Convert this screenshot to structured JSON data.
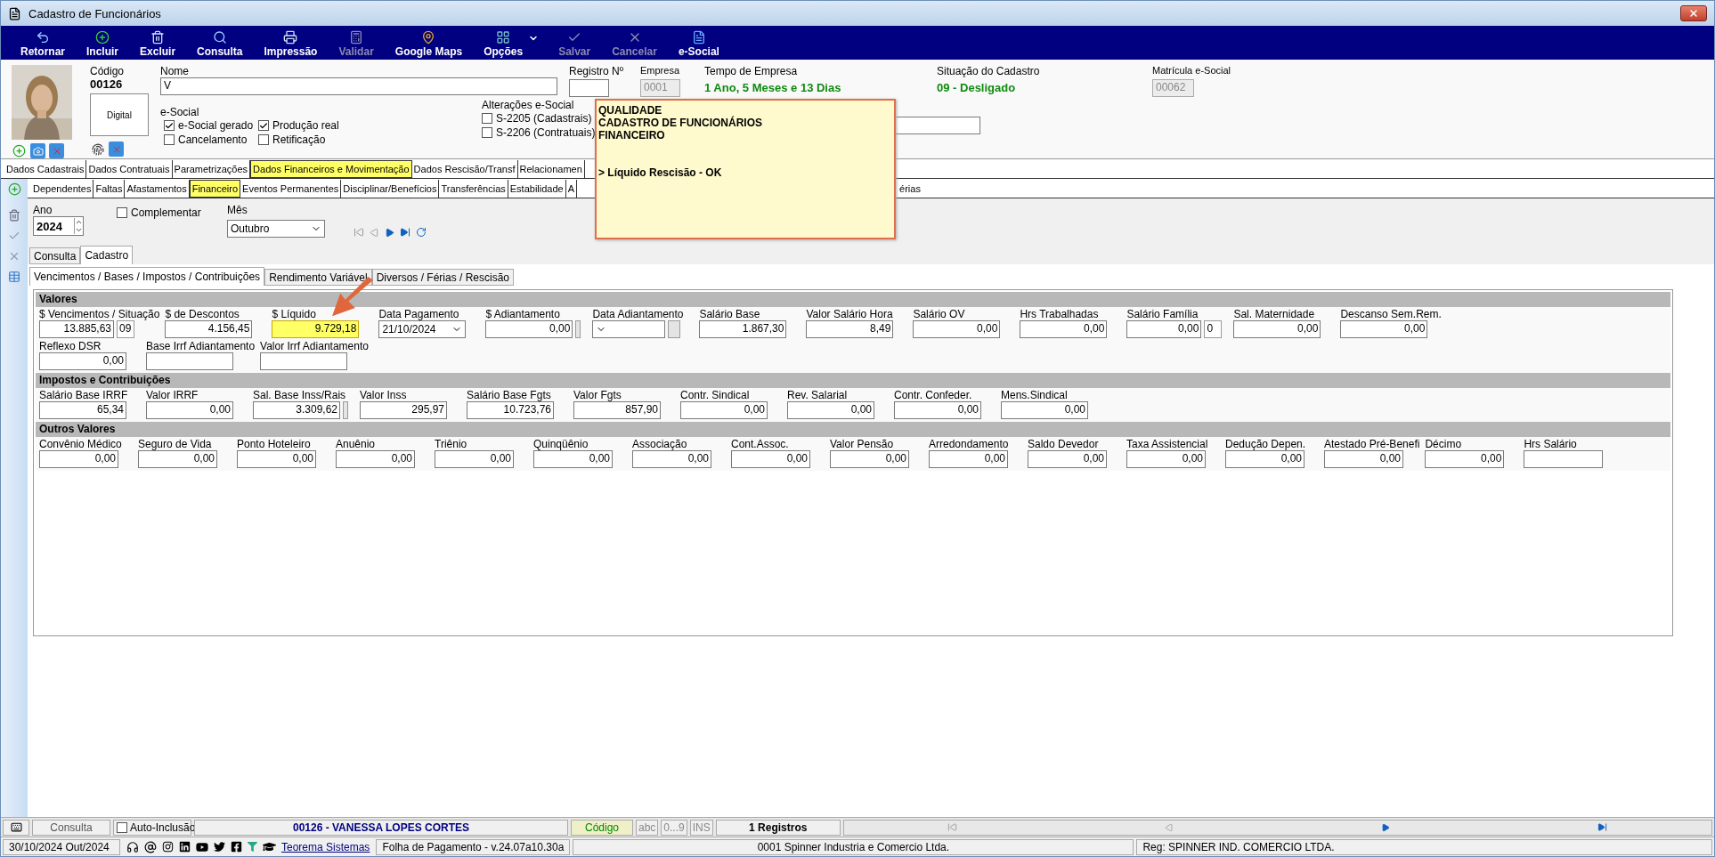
{
  "window": {
    "title": "Cadastro de Funcionários"
  },
  "toolbar": [
    {
      "label": "Retornar",
      "disabled": false,
      "menu": false
    },
    {
      "label": "Incluir",
      "disabled": false,
      "menu": false
    },
    {
      "label": "Excluir",
      "disabled": false,
      "menu": false
    },
    {
      "label": "Consulta",
      "disabled": false,
      "menu": false
    },
    {
      "label": "Impressão",
      "disabled": false,
      "menu": false
    },
    {
      "label": "Validar",
      "disabled": true,
      "menu": false
    },
    {
      "label": "Google Maps",
      "disabled": false,
      "menu": false
    },
    {
      "label": "Opções",
      "disabled": false,
      "menu": true
    },
    {
      "label": "Salvar",
      "disabled": true,
      "menu": false
    },
    {
      "label": "Cancelar",
      "disabled": true,
      "menu": false
    },
    {
      "label": "e-Social",
      "disabled": false,
      "menu": false
    }
  ],
  "header": {
    "codigo_label": "Código",
    "codigo": "00126",
    "digital": "Digital",
    "nome_label": "Nome",
    "nome": "V",
    "registro_label": "Registro Nº",
    "empresa_label": "Empresa",
    "empresa": "0001",
    "tempo_label": "Tempo de Empresa",
    "tempo": "1 Ano, 5 Meses  e 13 Dias",
    "situacao_label": "Situação do Cadastro",
    "situacao": "09 - Desligado",
    "matricula_label": "Matrícula e-Social",
    "matricula": "00062",
    "esocial_label": "e-Social",
    "esocial": [
      {
        "label": "e-Social gerado",
        "checked": true
      },
      {
        "label": "Produção real",
        "checked": true
      },
      {
        "label": "Cancelamento",
        "checked": false
      },
      {
        "label": "Retificação",
        "checked": false
      }
    ],
    "alteracoes_label": "Alterações e-Social",
    "alteracoes": [
      {
        "label": "S-2205 (Cadastrais)",
        "checked": false
      },
      {
        "label": "S-2206 (Contratuais)",
        "checked": false
      }
    ]
  },
  "note": {
    "lines": [
      "QUALIDADE",
      "CADASTRO DE FUNCIONÁRIOS",
      "FINANCEIRO"
    ],
    "message": "> Líquido Rescisão - OK"
  },
  "main_tabs": [
    {
      "label": "Dados Cadastrais",
      "selected": false
    },
    {
      "label": "Dados Contratuais",
      "selected": false
    },
    {
      "label": "Parametrizações",
      "selected": false
    },
    {
      "label": "Dados Financeiros e Movimentação",
      "selected": true
    },
    {
      "label": "Dados Rescisão/Transf",
      "selected": false
    },
    {
      "label": "Relacionamen",
      "selected": false
    }
  ],
  "sub_tabs": [
    {
      "label": "Dependentes",
      "selected": false
    },
    {
      "label": "Faltas",
      "selected": false
    },
    {
      "label": "Afastamentos",
      "selected": false
    },
    {
      "label": "Financeiro",
      "selected": true
    },
    {
      "label": "Eventos Permanentes",
      "selected": false
    },
    {
      "label": "Disciplinar/Benefícios",
      "selected": false
    },
    {
      "label": "Transferências",
      "selected": false
    },
    {
      "label": "Estabilidade",
      "selected": false
    },
    {
      "label": "A",
      "selected": false
    }
  ],
  "sub_tabs_right": [
    "érias"
  ],
  "filter": {
    "ano_label": "Ano",
    "ano": "2024",
    "complementar": {
      "label": "Complementar",
      "checked": false
    },
    "mes_label": "Mês",
    "mes": "Outubro"
  },
  "view_tabs": [
    {
      "label": "Consulta",
      "selected": false
    },
    {
      "label": "Cadastro",
      "selected": true
    }
  ],
  "page_tabs": [
    {
      "label": "Vencimentos / Bases / Impostos / Contribuições",
      "selected": true
    },
    {
      "label": "Rendimento Variável",
      "selected": false
    },
    {
      "label": "Diversos / Férias / Rescisão",
      "selected": false
    }
  ],
  "sections": [
    {
      "title": "Valores",
      "rows": [
        [
          {
            "label": "$ Vencimentos / Situação",
            "value": "13.885,63",
            "kind": "code",
            "code": "09",
            "highlighted": false
          },
          {
            "label": "$ de Descontos",
            "value": "4.156,45",
            "kind": "number",
            "highlighted": false
          },
          {
            "label": "$ Líquido",
            "value": "9.729,18",
            "kind": "number",
            "highlighted": true
          },
          {
            "label": "Data Pagamento",
            "value": "21/10/2024",
            "kind": "select",
            "highlighted": false
          },
          {
            "label": "$ Adiantamento",
            "value": "0,00",
            "kind": "button",
            "highlighted": false
          },
          {
            "label": "Data Adiantamento",
            "kind": "select_button",
            "highlighted": false
          },
          {
            "label": "Salário Base",
            "value": "1.867,30",
            "kind": "number",
            "highlighted": false
          },
          {
            "label": "Valor Salário Hora",
            "value": "8,49",
            "kind": "number",
            "highlighted": false
          },
          {
            "label": "Salário OV",
            "value": "0,00",
            "kind": "number",
            "highlighted": false
          },
          {
            "label": "Hrs Trabalhadas",
            "value": "0,00",
            "kind": "number",
            "highlighted": false
          },
          {
            "label": "Salário Família",
            "value": "0,00",
            "kind": "code",
            "code": "0",
            "highlighted": false
          },
          {
            "label": "Sal. Maternidade",
            "value": "0,00",
            "kind": "number",
            "highlighted": false
          },
          {
            "label": "Descanso Sem.Rem.",
            "value": "0,00",
            "kind": "number",
            "highlighted": false
          }
        ],
        [
          {
            "label": "Reflexo DSR",
            "value": "0,00",
            "kind": "number",
            "highlighted": false
          },
          {
            "label": "Base Irrf Adiantamento",
            "kind": "number",
            "highlighted": false
          },
          {
            "label": "Valor Irrf Adiantamento",
            "kind": "number",
            "highlighted": false
          }
        ]
      ]
    },
    {
      "title": "Impostos e Contribuições",
      "rows": [
        [
          {
            "label": "Salário Base IRRF",
            "value": "65,34",
            "kind": "number",
            "highlighted": false
          },
          {
            "label": "Valor IRRF",
            "value": "0,00",
            "kind": "number",
            "highlighted": false
          },
          {
            "label": "Sal. Base Inss/Rais",
            "value": "3.309,62",
            "kind": "button",
            "highlighted": false
          },
          {
            "label": "Valor Inss",
            "value": "295,97",
            "kind": "number",
            "highlighted": false
          },
          {
            "label": "Salário Base Fgts",
            "value": "10.723,76",
            "kind": "number",
            "highlighted": false
          },
          {
            "label": "Valor Fgts",
            "value": "857,90",
            "kind": "number",
            "highlighted": false
          },
          {
            "label": "Contr. Sindical",
            "value": "0,00",
            "kind": "number",
            "highlighted": false
          },
          {
            "label": "Rev. Salarial",
            "value": "0,00",
            "kind": "number",
            "highlighted": false
          },
          {
            "label": "Contr. Confeder.",
            "value": "0,00",
            "kind": "number",
            "highlighted": false
          },
          {
            "label": "Mens.Sindical",
            "value": "0,00",
            "kind": "number",
            "highlighted": false
          }
        ]
      ]
    },
    {
      "title": "Outros Valores",
      "rows": [
        [
          {
            "label": "Convênio Médico",
            "value": "0,00",
            "kind": "number",
            "highlighted": false
          },
          {
            "label": "Seguro de Vida",
            "value": "0,00",
            "kind": "number",
            "highlighted": false
          },
          {
            "label": "Ponto Hoteleiro",
            "value": "0,00",
            "kind": "number",
            "highlighted": false
          },
          {
            "label": "Anuênio",
            "value": "0,00",
            "kind": "number",
            "highlighted": false
          },
          {
            "label": "Triênio",
            "value": "0,00",
            "kind": "number",
            "highlighted": false
          },
          {
            "label": "Quinqüênio",
            "value": "0,00",
            "kind": "number",
            "highlighted": false
          },
          {
            "label": "Associação",
            "value": "0,00",
            "kind": "number",
            "highlighted": false
          },
          {
            "label": "Cont.Assoc.",
            "value": "0,00",
            "kind": "number",
            "highlighted": false
          },
          {
            "label": "Valor Pensão",
            "value": "0,00",
            "kind": "number",
            "highlighted": false
          },
          {
            "label": "Arredondamento",
            "value": "0,00",
            "kind": "number",
            "highlighted": false
          },
          {
            "label": "Saldo Devedor",
            "value": "0,00",
            "kind": "number",
            "highlighted": false
          },
          {
            "label": "Taxa Assistencial",
            "value": "0,00",
            "kind": "number",
            "highlighted": false
          },
          {
            "label": "Dedução Depen.",
            "value": "0,00",
            "kind": "number",
            "highlighted": false
          },
          {
            "label": "Atestado Pré-Benefi",
            "value": "0,00",
            "kind": "number",
            "highlighted": false
          },
          {
            "label": "Décimo",
            "value": "0,00",
            "kind": "number",
            "highlighted": false
          },
          {
            "label": "Hrs Salário",
            "kind": "number",
            "highlighted": false
          }
        ]
      ]
    }
  ],
  "status_bar": {
    "mode": "Consulta",
    "auto_inclusao": {
      "label": "Auto-Inclusão",
      "checked": false
    },
    "employee": "00126 - VANESSA LOPES CORTES",
    "order": "Código",
    "keys": [
      "abc",
      "0...9",
      "INS"
    ],
    "records": "1 Registros"
  },
  "footer": {
    "date": "30/10/2024 Out/2024",
    "link": "Teorema Sistemas",
    "version": "Folha de Pagamento - v.24.07a10.30a",
    "company": "0001 Spinner Industria e Comercio Ltda.",
    "reg": "Reg: SPINNER IND. COMERCIO LTDA."
  }
}
